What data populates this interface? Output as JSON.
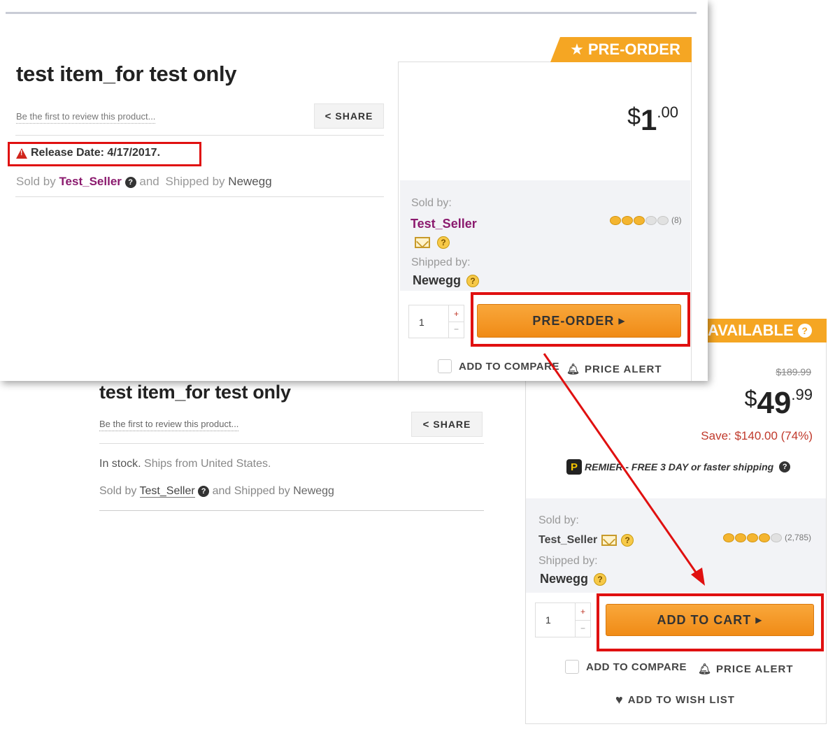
{
  "colors": {
    "accent_orange": "#f5a623",
    "highlight_red": "#e01010",
    "seller_purple": "#8b1a6e",
    "save_red": "#c0392b"
  },
  "shot1": {
    "title": "test item_for test only",
    "review_link": "Be the first to review this product...",
    "share_label": "SHARE",
    "release_date": "Release Date: 4/17/2017.",
    "sold_prefix": "Sold by",
    "seller": "Test_Seller",
    "and_text": "and",
    "shipped_prefix": "Shipped by",
    "shipper": "Newegg",
    "tag": "PRE-ORDER",
    "price": {
      "currency": "$",
      "dollars": "1",
      "cents": ".00"
    },
    "sold_by_label": "Sold by:",
    "shipped_by_label": "Shipped by:",
    "rating": {
      "filled": 3,
      "total": 5,
      "count": "(8)"
    },
    "quantity": "1",
    "button": "PRE-ORDER",
    "compare": "ADD TO COMPARE",
    "price_alert": "PRICE ALERT"
  },
  "shot2": {
    "title": "test item_for test only",
    "review_link": "Be the first to review this product...",
    "share_label": "SHARE",
    "stock": "In stock.",
    "ships_from": "Ships from United States.",
    "sold_prefix": "Sold by",
    "seller": "Test_Seller",
    "and_shipped": "and Shipped by",
    "shipper": "Newegg",
    "tag": "AVAILABLE",
    "was_price": "$189.99",
    "price": {
      "currency": "$",
      "dollars": "49",
      "cents": ".99"
    },
    "save": "Save: $140.00 (74%)",
    "premier_letter": "P",
    "premier": "REMIER - FREE 3 DAY or faster shipping",
    "sold_by_label": "Sold by:",
    "shipped_by_label": "Shipped by:",
    "rating": {
      "filled": 4,
      "total": 5,
      "count": "(2,785)"
    },
    "quantity": "1",
    "button": "ADD TO CART",
    "compare": "ADD TO COMPARE",
    "price_alert": "PRICE ALERT",
    "wish_list": "ADD TO WISH LIST"
  },
  "icons": {
    "star": "star-icon",
    "warning": "warning-icon",
    "help": "question-circle-icon",
    "share": "share-icon",
    "bell": "bell-icon",
    "heart": "heart-icon",
    "mail": "envelope-icon",
    "caret": "caret-right-icon"
  }
}
